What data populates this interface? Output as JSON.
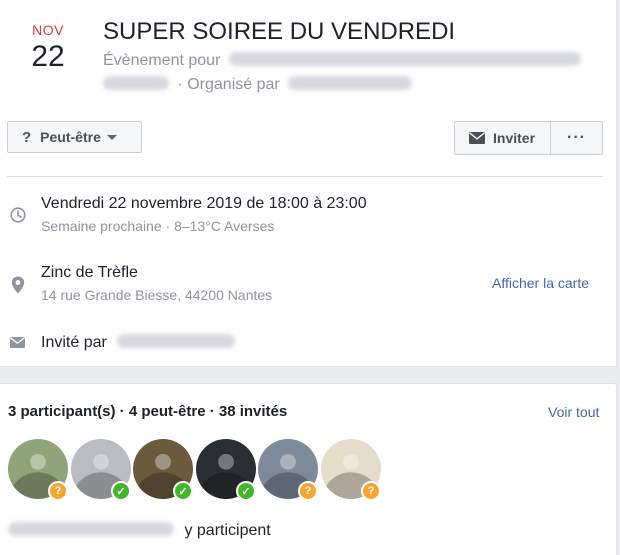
{
  "event": {
    "month": "NOV",
    "day": "22",
    "title": "SUPER SOIREE DU VENDREDI",
    "type_prefix": "Évènement pour",
    "organized_by": "· Organisé par"
  },
  "actions": {
    "rsvp_icon": "?",
    "rsvp_label": "Peut-être",
    "invite_label": "Inviter",
    "more_label": "···"
  },
  "details": {
    "datetime": "Vendredi 22 novembre 2019 de 18:00 à 23:00",
    "datetime_sub": "Semaine prochaine · 8–13°C Averses",
    "place_name": "Zinc de Trèfle",
    "place_address": "14 rue Grande Biesse, 44200 Nantes",
    "map_link": "Afficher la carte",
    "invited_by": "Invité par"
  },
  "guests": {
    "summary": "3 participant(s) · 4 peut-être · 38 invités",
    "see_all": "Voir tout",
    "participate_suffix": "y participent",
    "avatars": [
      {
        "status": "maybe",
        "bg": "#8fa478"
      },
      {
        "status": "going",
        "bg": "#b9bcc0"
      },
      {
        "status": "going",
        "bg": "#6b5a3d"
      },
      {
        "status": "going",
        "bg": "#2b2e33"
      },
      {
        "status": "maybe",
        "bg": "#7d8a99"
      },
      {
        "status": "maybe",
        "bg": "#e6dccb"
      }
    ]
  },
  "colors": {
    "accent_link": "#4267b2",
    "month_red": "#e0393e",
    "going_green": "#42b72a",
    "maybe_orange": "#f7a52e"
  }
}
